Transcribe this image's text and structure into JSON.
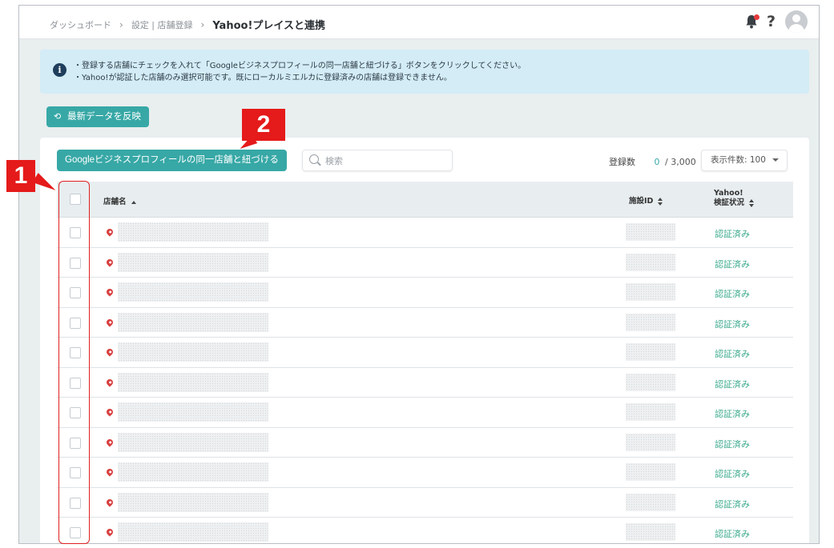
{
  "breadcrumb": {
    "items": [
      "ダッシュボード",
      "設定 | 店舗登録"
    ],
    "separator": "›",
    "current": "Yahoo!プレイスと連携"
  },
  "header": {
    "bell_icon": "bell-icon",
    "help_label": "?",
    "avatar_icon": "user-avatar-icon"
  },
  "info": {
    "icon_label": "i",
    "lines": [
      "・登録する店舗にチェックを入れて「Googleビジネスプロフィールの同一店舗と紐づける」ボタンをクリックしてください。",
      "・Yahoo!が認証した店舗のみ選択可能です。既にローカルミエルカに登録済みの店舗は登録できません。"
    ]
  },
  "toolbar": {
    "refresh_label": "最新データを反映",
    "link_label": "Googleビジネスプロフィールの同一店舗と紐づける",
    "search_placeholder": "検索",
    "count_label": "登録数",
    "count_value": "0",
    "count_total": "/ 3,000",
    "per_page_label": "表示件数: 100"
  },
  "table": {
    "columns": {
      "name": "店舗名",
      "facility_id": "施設ID",
      "yahoo_line1": "Yahoo!",
      "yahoo_line2": "検証状況"
    },
    "rows": [
      {
        "status": "認証済み"
      },
      {
        "status": "認証済み"
      },
      {
        "status": "認証済み"
      },
      {
        "status": "認証済み"
      },
      {
        "status": "認証済み"
      },
      {
        "status": "認証済み"
      },
      {
        "status": "認証済み"
      },
      {
        "status": "認証済み"
      },
      {
        "status": "認証済み"
      },
      {
        "status": "認証済み"
      },
      {
        "status": "認証済み"
      }
    ]
  },
  "annotations": {
    "badge1": "1",
    "badge2": "2"
  },
  "colors": {
    "accent": "#37a8a6",
    "verified": "#3aa98c",
    "callout": "#e51a1a",
    "info_bg": "#d3ecf6"
  }
}
